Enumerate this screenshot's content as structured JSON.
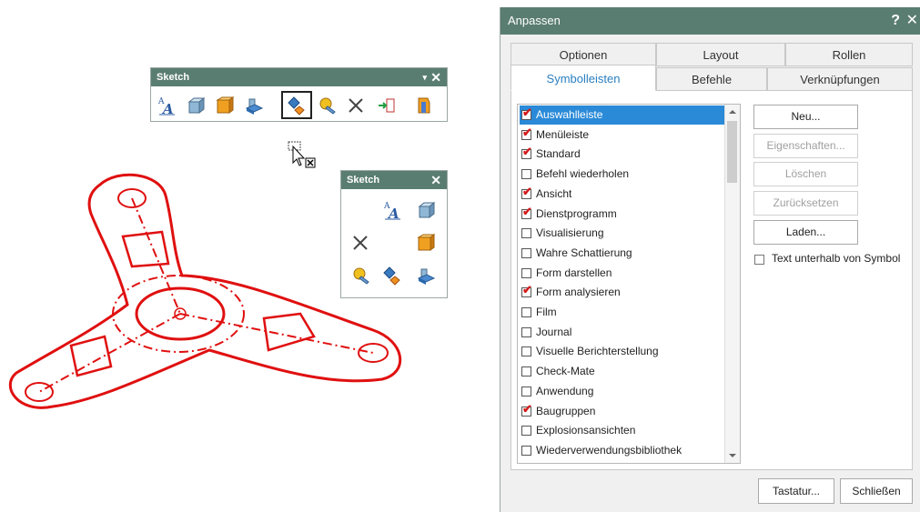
{
  "toolbar_top": {
    "title": "Sketch",
    "pin": "▾",
    "close": "✕"
  },
  "toolbar_float": {
    "title": "Sketch",
    "close": "✕"
  },
  "dialog": {
    "title": "Anpassen",
    "help": "?",
    "close": "✕",
    "tabs_row1": [
      "Optionen",
      "Layout",
      "Rollen"
    ],
    "tabs_row2": [
      "Symbolleisten",
      "Befehle",
      "Verknüpfungen"
    ],
    "toolbars": [
      {
        "label": "Auswahlleiste",
        "checked": true,
        "selected": true
      },
      {
        "label": "Menüleiste",
        "checked": true
      },
      {
        "label": "Standard",
        "checked": true
      },
      {
        "label": "Befehl wiederholen",
        "checked": false
      },
      {
        "label": "Ansicht",
        "checked": true
      },
      {
        "label": "Dienstprogramm",
        "checked": true
      },
      {
        "label": "Visualisierung",
        "checked": false
      },
      {
        "label": "Wahre Schattierung",
        "checked": false
      },
      {
        "label": "Form darstellen",
        "checked": false
      },
      {
        "label": "Form analysieren",
        "checked": true
      },
      {
        "label": "Film",
        "checked": false
      },
      {
        "label": "Journal",
        "checked": false
      },
      {
        "label": "Visuelle Berichterstellung",
        "checked": false
      },
      {
        "label": "Check-Mate",
        "checked": false
      },
      {
        "label": "Anwendung",
        "checked": false
      },
      {
        "label": "Baugruppen",
        "checked": true
      },
      {
        "label": "Explosionsansichten",
        "checked": false
      },
      {
        "label": "Wiederverwendungsbibliothek",
        "checked": false
      }
    ],
    "buttons": {
      "new": "Neu...",
      "properties": "Eigenschaften...",
      "delete": "Löschen",
      "reset": "Zurücksetzen",
      "load": "Laden..."
    },
    "text_below_icon": "Text unterhalb von Symbol",
    "keyboard": "Tastatur...",
    "close_btn": "Schließen"
  },
  "colors": {
    "titlebar": "#5a7d72",
    "sketch": "#e01010",
    "accent": "#2a8ad8"
  }
}
